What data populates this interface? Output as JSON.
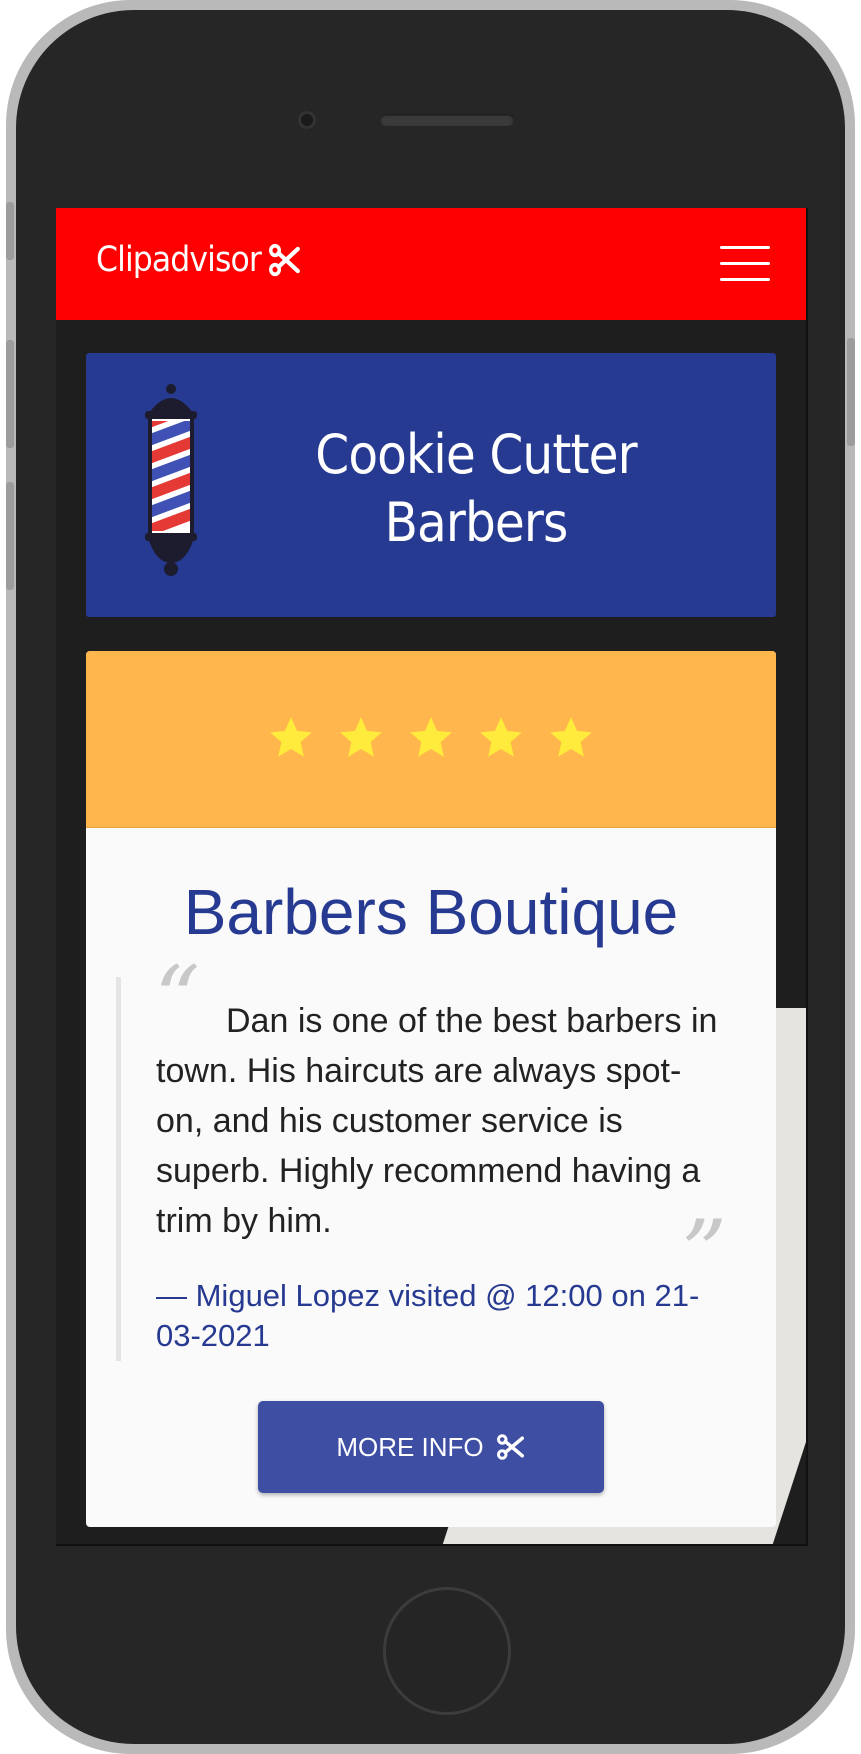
{
  "nav": {
    "brand": "Clipadvisor",
    "brand_icon": "scissors-icon",
    "menu_icon": "hamburger-menu-icon",
    "bar_color": "#ff0000"
  },
  "shop": {
    "name": "Cookie Cutter Barbers",
    "icon": "barber-pole-icon",
    "card_color": "#273a91"
  },
  "review": {
    "rating": 5,
    "rating_max": 5,
    "band_color": "#ffb74d",
    "star_color": "#ffeb3b",
    "barber": "Barbers Boutique",
    "text": "Dan is one of the best barbers in town. His haircuts are always spot-on, and his customer service is superb. Highly recommend having a trim by him.",
    "meta": "— Miguel Lopez visited @ 12:00 on 21-03-2021",
    "button_label": "MORE INFO",
    "button_icon": "scissors-icon"
  }
}
